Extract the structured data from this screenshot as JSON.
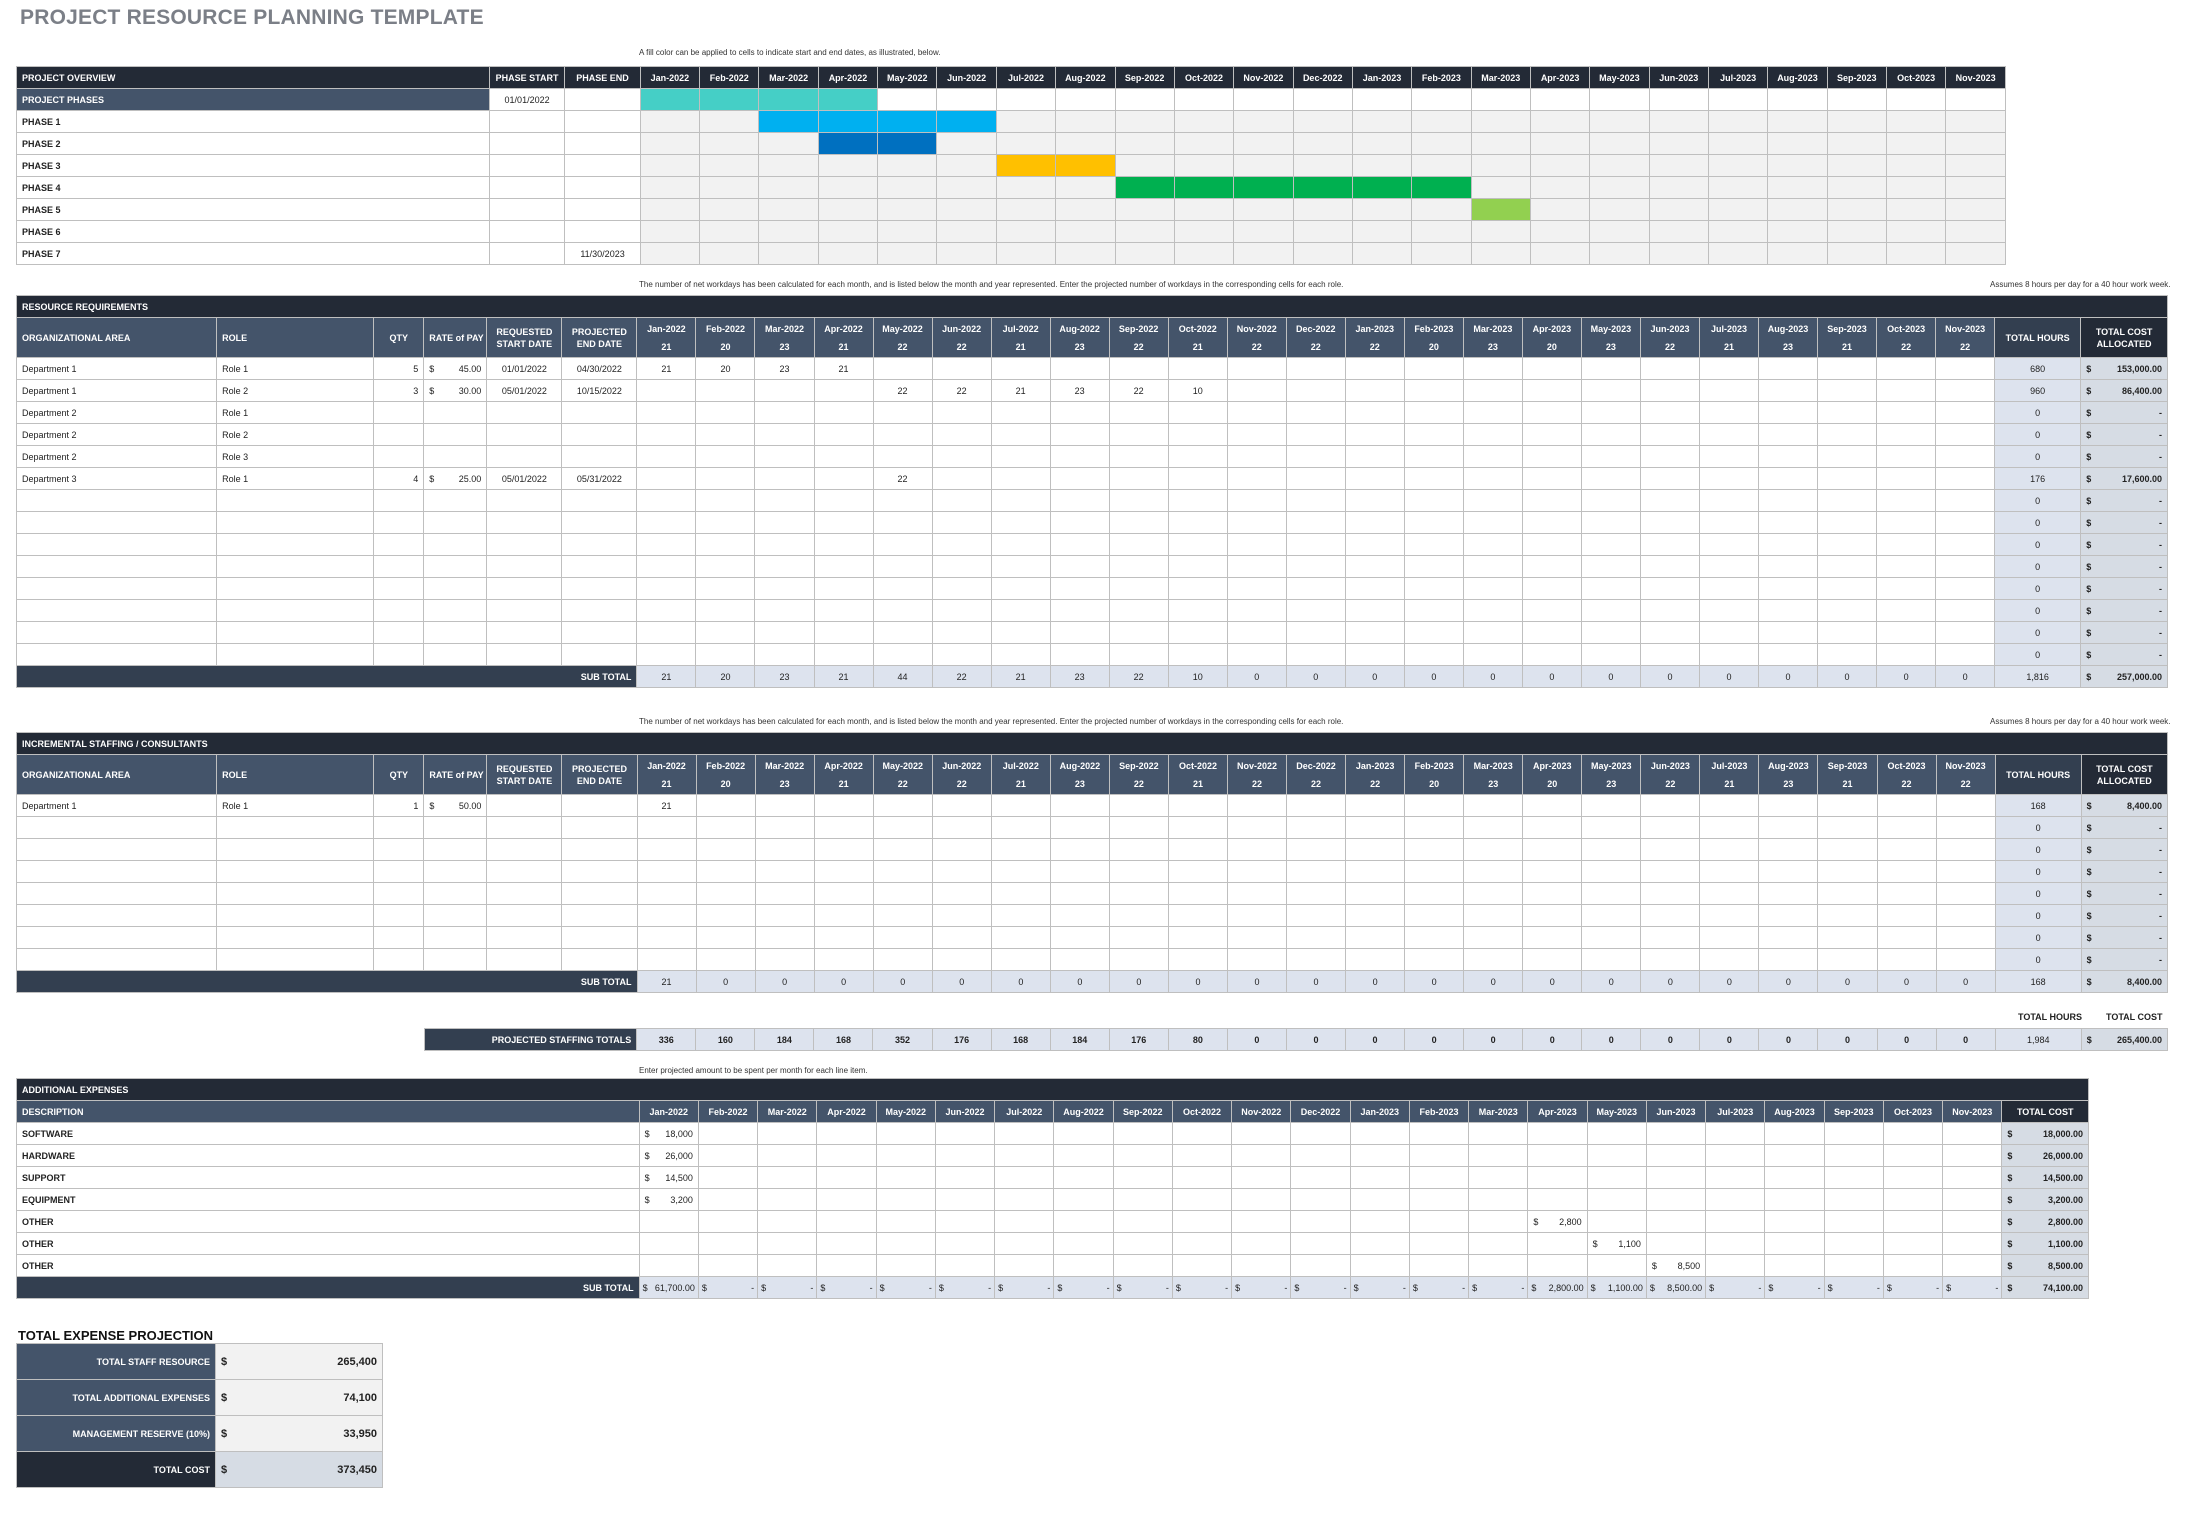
{
  "title": "PROJECT RESOURCE PLANNING TEMPLATE",
  "months": [
    "Jan-2022",
    "Feb-2022",
    "Mar-2022",
    "Apr-2022",
    "May-2022",
    "Jun-2022",
    "Jul-2022",
    "Aug-2022",
    "Sep-2022",
    "Oct-2022",
    "Nov-2022",
    "Dec-2022",
    "Jan-2023",
    "Feb-2023",
    "Mar-2023",
    "Apr-2023",
    "May-2023",
    "Jun-2023",
    "Jul-2023",
    "Aug-2023",
    "Sep-2023",
    "Oct-2023",
    "Nov-2023"
  ],
  "workdays": [
    "21",
    "20",
    "23",
    "21",
    "22",
    "22",
    "21",
    "23",
    "22",
    "21",
    "22",
    "22",
    "22",
    "20",
    "23",
    "20",
    "23",
    "22",
    "21",
    "23",
    "21",
    "22",
    "22"
  ],
  "notes": {
    "fill_color": "A fill color can be applied to cells to indicate start and end dates, as illustrated, below.",
    "workdays": "The number of net workdays has been calculated for each month, and is listed below the month and year represented. Enter the projected number of workdays in the corresponding cells for each role.",
    "hours_assumption": "Assumes 8 hours per day for a 40 hour work week.",
    "expenses": "Enter projected amount to be spent per month for each line item."
  },
  "overview": {
    "header": "PROJECT OVERVIEW",
    "phase_start_label": "PHASE START",
    "phase_end_label": "PHASE END",
    "rows": [
      {
        "label": "PROJECT PHASES",
        "start": "01/01/2022",
        "end": "",
        "fill": [
          0,
          1,
          2,
          3
        ],
        "color": "#45cfc6"
      },
      {
        "label": "PHASE 1",
        "start": "",
        "end": "",
        "fill": [
          2,
          3,
          4,
          5
        ],
        "color": "#00b0f0"
      },
      {
        "label": "PHASE 2",
        "start": "",
        "end": "",
        "fill": [
          3,
          4
        ],
        "color": "#0070c0"
      },
      {
        "label": "PHASE 3",
        "start": "",
        "end": "",
        "fill": [
          6,
          7
        ],
        "color": "#ffc000"
      },
      {
        "label": "PHASE 4",
        "start": "",
        "end": "",
        "fill": [
          8,
          9,
          10,
          11,
          12,
          13
        ],
        "color": "#00b050"
      },
      {
        "label": "PHASE 5",
        "start": "",
        "end": "",
        "fill": [
          14
        ],
        "color": "#92d050"
      },
      {
        "label": "PHASE 6",
        "start": "",
        "end": "",
        "fill": [],
        "color": ""
      },
      {
        "label": "PHASE 7",
        "start": "",
        "end": "11/30/2023",
        "fill": [],
        "color": ""
      }
    ]
  },
  "columns": {
    "org_area": "ORGANIZATIONAL AREA",
    "role": "ROLE",
    "qty": "QTY",
    "rate": "RATE of PAY",
    "req_start": "REQUESTED START DATE",
    "proj_end": "PROJECTED END DATE",
    "total_hours": "TOTAL HOURS",
    "total_cost_alloc": "TOTAL COST ALLOCATED",
    "subtotal": "SUB TOTAL",
    "currency": "$"
  },
  "resource": {
    "header": "RESOURCE REQUIREMENTS",
    "rows": [
      {
        "org": "Department 1",
        "role": "Role 1",
        "qty": "5",
        "rate": "45.00",
        "start": "01/01/2022",
        "end": "04/30/2022",
        "days": {
          "0": "21",
          "1": "20",
          "2": "23",
          "3": "21"
        },
        "hours": "680",
        "cost": "153,000.00"
      },
      {
        "org": "Department 1",
        "role": "Role 2",
        "qty": "3",
        "rate": "30.00",
        "start": "05/01/2022",
        "end": "10/15/2022",
        "days": {
          "4": "22",
          "5": "22",
          "6": "21",
          "7": "23",
          "8": "22",
          "9": "10"
        },
        "hours": "960",
        "cost": "86,400.00"
      },
      {
        "org": "Department 2",
        "role": "Role 1",
        "qty": "",
        "rate": "",
        "start": "",
        "end": "",
        "days": {},
        "hours": "0",
        "cost": "-"
      },
      {
        "org": "Department 2",
        "role": "Role 2",
        "qty": "",
        "rate": "",
        "start": "",
        "end": "",
        "days": {},
        "hours": "0",
        "cost": "-"
      },
      {
        "org": "Department 2",
        "role": "Role 3",
        "qty": "",
        "rate": "",
        "start": "",
        "end": "",
        "days": {},
        "hours": "0",
        "cost": "-"
      },
      {
        "org": "Department 3",
        "role": "Role 1",
        "qty": "4",
        "rate": "25.00",
        "start": "05/01/2022",
        "end": "05/31/2022",
        "days": {
          "4": "22"
        },
        "hours": "176",
        "cost": "17,600.00"
      },
      {
        "org": "",
        "role": "",
        "qty": "",
        "rate": "",
        "start": "",
        "end": "",
        "days": {},
        "hours": "0",
        "cost": "-"
      },
      {
        "org": "",
        "role": "",
        "qty": "",
        "rate": "",
        "start": "",
        "end": "",
        "days": {},
        "hours": "0",
        "cost": "-"
      },
      {
        "org": "",
        "role": "",
        "qty": "",
        "rate": "",
        "start": "",
        "end": "",
        "days": {},
        "hours": "0",
        "cost": "-"
      },
      {
        "org": "",
        "role": "",
        "qty": "",
        "rate": "",
        "start": "",
        "end": "",
        "days": {},
        "hours": "0",
        "cost": "-"
      },
      {
        "org": "",
        "role": "",
        "qty": "",
        "rate": "",
        "start": "",
        "end": "",
        "days": {},
        "hours": "0",
        "cost": "-"
      },
      {
        "org": "",
        "role": "",
        "qty": "",
        "rate": "",
        "start": "",
        "end": "",
        "days": {},
        "hours": "0",
        "cost": "-"
      },
      {
        "org": "",
        "role": "",
        "qty": "",
        "rate": "",
        "start": "",
        "end": "",
        "days": {},
        "hours": "0",
        "cost": "-"
      },
      {
        "org": "",
        "role": "",
        "qty": "",
        "rate": "",
        "start": "",
        "end": "",
        "days": {},
        "hours": "0",
        "cost": "-"
      }
    ],
    "subtotal": [
      "21",
      "20",
      "23",
      "21",
      "44",
      "22",
      "21",
      "23",
      "22",
      "10",
      "0",
      "0",
      "0",
      "0",
      "0",
      "0",
      "0",
      "0",
      "0",
      "0",
      "0",
      "0",
      "0"
    ],
    "subtotal_hours": "1,816",
    "subtotal_cost": "257,000.00"
  },
  "incremental": {
    "header": "INCREMENTAL STAFFING / CONSULTANTS",
    "rows": [
      {
        "org": "Department 1",
        "role": "Role 1",
        "qty": "1",
        "rate": "50.00",
        "start": "",
        "end": "",
        "days": {
          "0": "21"
        },
        "hours": "168",
        "cost": "8,400.00"
      },
      {
        "org": "",
        "role": "",
        "qty": "",
        "rate": "",
        "start": "",
        "end": "",
        "days": {},
        "hours": "0",
        "cost": "-"
      },
      {
        "org": "",
        "role": "",
        "qty": "",
        "rate": "",
        "start": "",
        "end": "",
        "days": {},
        "hours": "0",
        "cost": "-"
      },
      {
        "org": "",
        "role": "",
        "qty": "",
        "rate": "",
        "start": "",
        "end": "",
        "days": {},
        "hours": "0",
        "cost": "-"
      },
      {
        "org": "",
        "role": "",
        "qty": "",
        "rate": "",
        "start": "",
        "end": "",
        "days": {},
        "hours": "0",
        "cost": "-"
      },
      {
        "org": "",
        "role": "",
        "qty": "",
        "rate": "",
        "start": "",
        "end": "",
        "days": {},
        "hours": "0",
        "cost": "-"
      },
      {
        "org": "",
        "role": "",
        "qty": "",
        "rate": "",
        "start": "",
        "end": "",
        "days": {},
        "hours": "0",
        "cost": "-"
      },
      {
        "org": "",
        "role": "",
        "qty": "",
        "rate": "",
        "start": "",
        "end": "",
        "days": {},
        "hours": "0",
        "cost": "-"
      }
    ],
    "subtotal": [
      "21",
      "0",
      "0",
      "0",
      "0",
      "0",
      "0",
      "0",
      "0",
      "0",
      "0",
      "0",
      "0",
      "0",
      "0",
      "0",
      "0",
      "0",
      "0",
      "0",
      "0",
      "0",
      "0"
    ],
    "subtotal_hours": "168",
    "subtotal_cost": "8,400.00"
  },
  "projected": {
    "label": "PROJECTED STAFFING TOTALS",
    "total_hours_label": "TOTAL HOURS",
    "total_cost_label": "TOTAL COST",
    "values": [
      "336",
      "160",
      "184",
      "168",
      "352",
      "176",
      "168",
      "184",
      "176",
      "80",
      "0",
      "0",
      "0",
      "0",
      "0",
      "0",
      "0",
      "0",
      "0",
      "0",
      "0",
      "0",
      "0"
    ],
    "hours": "1,984",
    "cost": "265,400.00"
  },
  "expenses": {
    "header": "ADDITIONAL EXPENSES",
    "description_label": "DESCRIPTION",
    "total_cost_label": "TOTAL COST",
    "rows": [
      {
        "label": "SOFTWARE",
        "values": {
          "0": "18,000"
        },
        "total": "18,000.00"
      },
      {
        "label": "HARDWARE",
        "values": {
          "0": "26,000"
        },
        "total": "26,000.00"
      },
      {
        "label": "SUPPORT",
        "values": {
          "0": "14,500"
        },
        "total": "14,500.00"
      },
      {
        "label": "EQUIPMENT",
        "values": {
          "0": "3,200"
        },
        "total": "3,200.00"
      },
      {
        "label": "OTHER",
        "values": {
          "15": "2,800"
        },
        "total": "2,800.00"
      },
      {
        "label": "OTHER",
        "values": {
          "16": "1,100"
        },
        "total": "1,100.00"
      },
      {
        "label": "OTHER",
        "values": {
          "17": "8,500"
        },
        "total": "8,500.00"
      }
    ],
    "subtotal": [
      "61,700.00",
      "-",
      "-",
      "-",
      "-",
      "-",
      "-",
      "-",
      "-",
      "-",
      "-",
      "-",
      "-",
      "-",
      "-",
      "2,800.00",
      "1,100.00",
      "8,500.00",
      "-",
      "-",
      "-",
      "-",
      "-"
    ],
    "subtotal_total": "74,100.00"
  },
  "projection": {
    "header": "TOTAL EXPENSE PROJECTION",
    "rows": [
      {
        "label": "TOTAL STAFF RESOURCE",
        "value": "265,400"
      },
      {
        "label": "TOTAL ADDITIONAL EXPENSES",
        "value": "74,100"
      },
      {
        "label": "MANAGEMENT RESERVE (10%)",
        "value": "33,950"
      }
    ],
    "total_label": "TOTAL COST",
    "total_value": "373,450"
  }
}
